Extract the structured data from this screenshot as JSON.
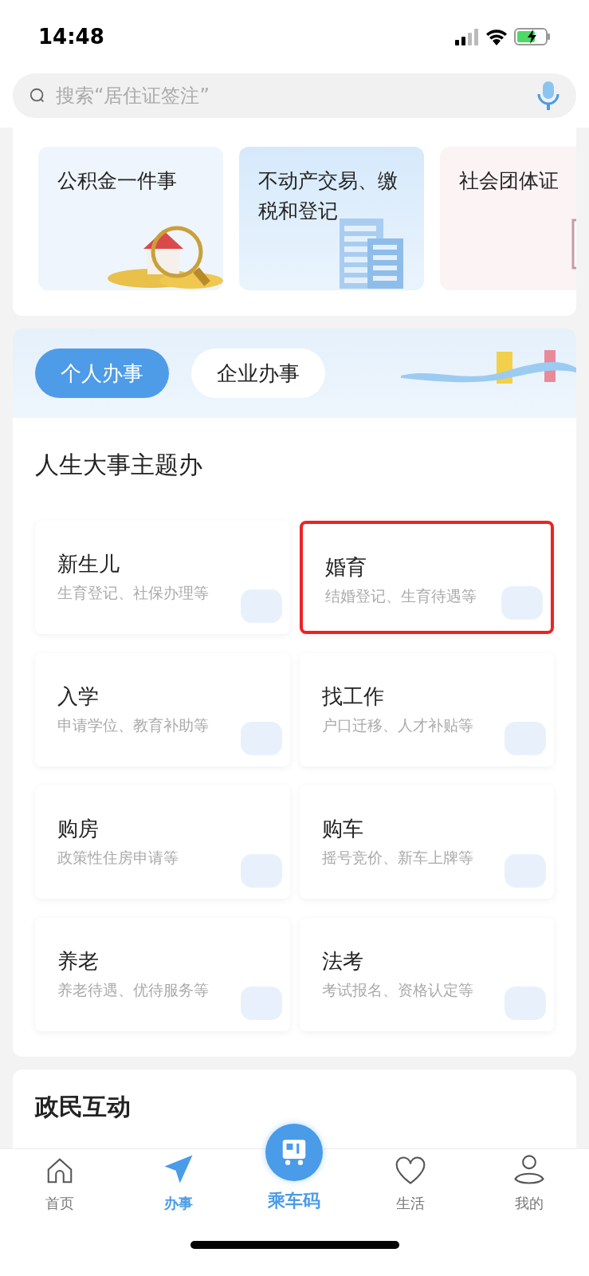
{
  "status_bar": {
    "time": "14:48"
  },
  "search": {
    "placeholder": "搜索“居住证签注”"
  },
  "featured": [
    {
      "title": "公积金一件事",
      "kind": "coins"
    },
    {
      "title": "不动产交易、缴税和登记",
      "kind": "building"
    },
    {
      "title": "社会团体证",
      "kind": "certificate"
    }
  ],
  "tabs": [
    {
      "label": "个人办事",
      "selected": true
    },
    {
      "label": "企业办事",
      "selected": false
    }
  ],
  "section": {
    "title": "人生大事主题办",
    "items": [
      {
        "title": "新生儿",
        "subtitle": "生育登记、社保办理等",
        "highlighted": false
      },
      {
        "title": "婚育",
        "subtitle": "结婚登记、生育待遇等",
        "highlighted": true
      },
      {
        "title": "入学",
        "subtitle": "申请学位、教育补助等",
        "highlighted": false
      },
      {
        "title": "找工作",
        "subtitle": "户口迁移、人才补贴等",
        "highlighted": false
      },
      {
        "title": "购房",
        "subtitle": "政策性住房申请等",
        "highlighted": false
      },
      {
        "title": "购车",
        "subtitle": "摇号竞价、新车上牌等",
        "highlighted": false
      },
      {
        "title": "养老",
        "subtitle": "养老待遇、优待服务等",
        "highlighted": false
      },
      {
        "title": "法考",
        "subtitle": "考试报名、资格认定等",
        "highlighted": false
      }
    ]
  },
  "next_section": {
    "title": "政民互动"
  },
  "bottom_nav": [
    {
      "label": "首页",
      "kind": "home",
      "selected": false
    },
    {
      "label": "办事",
      "kind": "send",
      "selected": true
    },
    {
      "label": "乘车码",
      "kind": "bus",
      "selected": false
    },
    {
      "label": "生活",
      "kind": "heart",
      "selected": false
    },
    {
      "label": "我的",
      "kind": "user",
      "selected": false
    }
  ]
}
